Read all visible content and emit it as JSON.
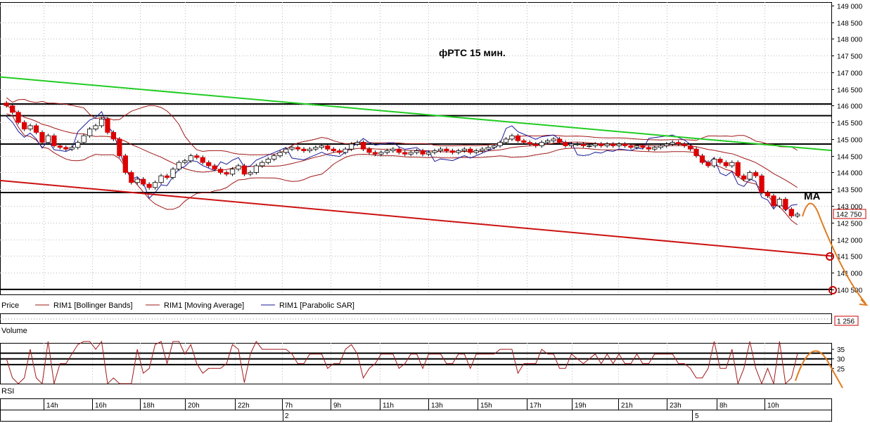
{
  "chart_data": {
    "type": "candlestick",
    "title": "фРТС    15 мин.",
    "price_axis": {
      "ylim": [
        140350,
        149100
      ],
      "ticks": [
        "149 000",
        "148 500",
        "148 000",
        "147 500",
        "147 000",
        "146 500",
        "146 000",
        "145 500",
        "145 000",
        "144 500",
        "144 000",
        "143 500",
        "143 000",
        "142 500",
        "142 000",
        "141 500",
        "141 000",
        "140 500"
      ],
      "tick_values": [
        149000,
        148500,
        148000,
        147500,
        147000,
        146500,
        146000,
        145500,
        145000,
        144500,
        144000,
        143500,
        143000,
        142500,
        142000,
        141500,
        141000,
        140500
      ],
      "last_price_label": "142 750",
      "last_price": 142750
    },
    "legend": [
      {
        "label": "Price",
        "color": "#cc0000"
      },
      {
        "label": "RIM1 [Bollinger Bands]",
        "color": "#a01818"
      },
      {
        "label": "RIM1 [Moving Average]",
        "color": "#a01818"
      },
      {
        "label": "RIM1 [Parabolic SAR]",
        "color": "#1a1a9a"
      }
    ],
    "candle_closes": [
      146000,
      145800,
      145500,
      145300,
      145400,
      145200,
      144900,
      145100,
      144800,
      144750,
      144700,
      144750,
      144900,
      145100,
      145300,
      145400,
      145600,
      145200,
      145000,
      144500,
      144000,
      143700,
      143800,
      143650,
      143550,
      143700,
      143900,
      143850,
      144100,
      144300,
      144350,
      144500,
      144450,
      144300,
      144200,
      144100,
      144000,
      143950,
      144100,
      144200,
      143950,
      144000,
      144200,
      144300,
      144400,
      144500,
      144600,
      144700,
      144750,
      144700,
      144650,
      144700,
      144750,
      144800,
      144700,
      144650,
      144600,
      144700,
      144850,
      144900,
      144700,
      144600,
      144550,
      144600,
      144650,
      144700,
      144600,
      144550,
      144600,
      144650,
      144550,
      144600,
      144650,
      144700,
      144650,
      144600,
      144650,
      144700,
      144600,
      144650,
      144700,
      144750,
      144800,
      144900,
      145000,
      145100,
      144950,
      144900,
      144850,
      144800,
      144900,
      144950,
      145000,
      144900,
      144800,
      144850,
      144850,
      144800,
      144800,
      144850,
      144800,
      144850,
      144800,
      144850,
      144800,
      144750,
      144800,
      144750,
      144700,
      144750,
      144800,
      144850,
      144900,
      144850,
      144800,
      144700,
      144500,
      144300,
      144200,
      144400,
      144300,
      144200,
      144300,
      143900,
      143800,
      144000,
      143900,
      143400,
      143300,
      143000,
      143200,
      142900,
      142700,
      142750
    ],
    "horizontal_levels": [
      146050,
      145700,
      144850,
      143400,
      140500
    ],
    "trend_lines": [
      {
        "name": "green",
        "color": "#22cc22",
        "from": [
          0,
          146860
        ],
        "to": [
          1,
          144660
        ]
      },
      {
        "name": "red",
        "color": "#cc1111",
        "from": [
          0,
          143760
        ],
        "to": [
          1,
          141500
        ]
      }
    ],
    "annotation": "MA",
    "arrow_color": "#e07b20",
    "x_labels": [
      "14h",
      "16h",
      "18h",
      "20h",
      "22h",
      "7h",
      "9h",
      "11h",
      "13h",
      "15h",
      "17h",
      "19h",
      "21h",
      "23h",
      "8h",
      "10h"
    ],
    "day_labels": [
      "2",
      "5"
    ],
    "volume": {
      "label": "Volume",
      "last_value_label": "1 256",
      "last_value": 1256
    },
    "rsi": {
      "label": "RSI",
      "ticks": [
        "35",
        "30",
        "25"
      ],
      "tick_values": [
        35,
        30,
        25
      ],
      "levels": [
        33,
        30,
        27
      ],
      "ylim": [
        17,
        38
      ]
    }
  }
}
